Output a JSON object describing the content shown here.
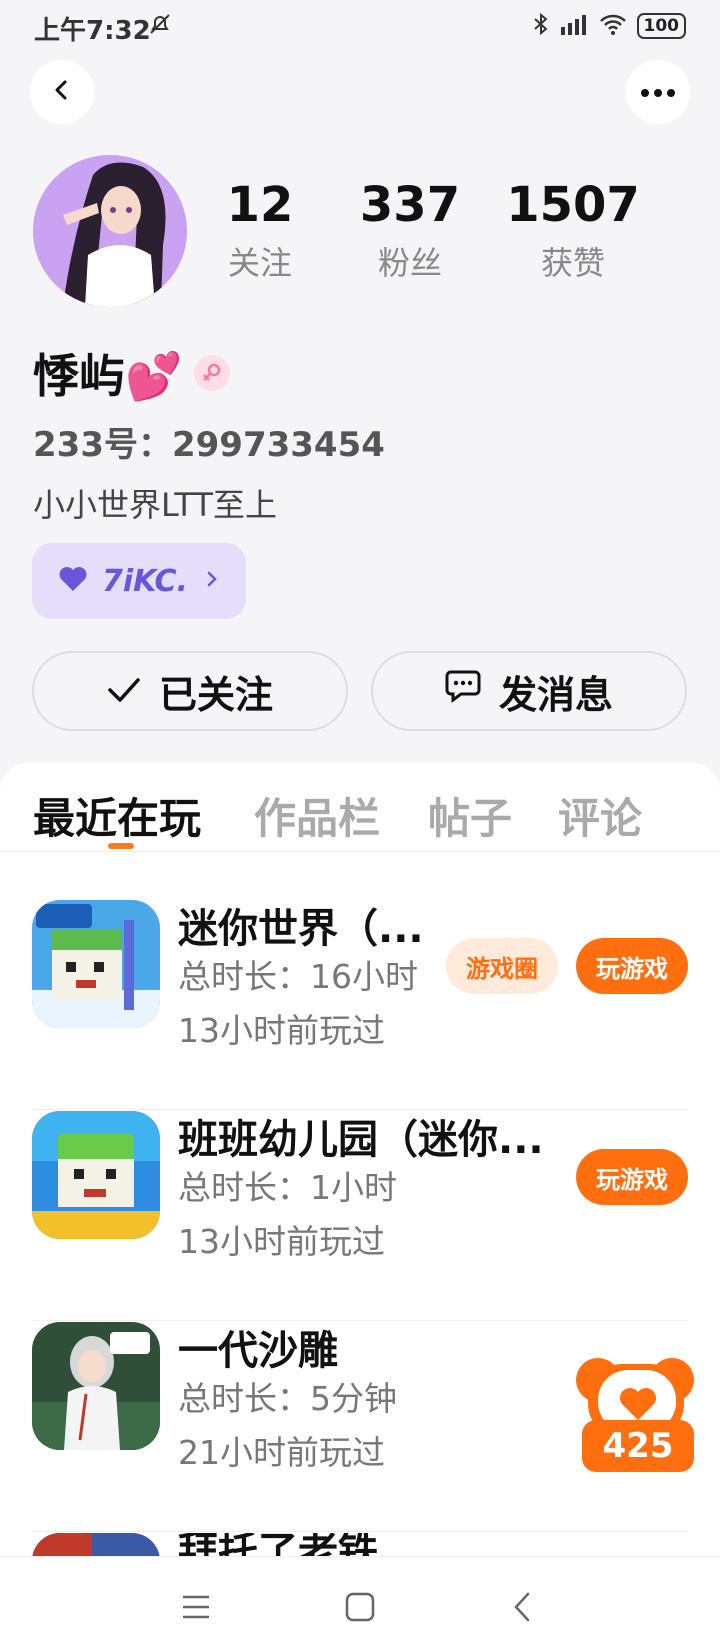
{
  "status_bar": {
    "time": "上午7:32",
    "battery": "100",
    "icons": [
      "mute-icon",
      "bluetooth-icon",
      "signal-icon",
      "wifi-icon",
      "battery-icon"
    ]
  },
  "header": {
    "back_icon": "chevron-left-icon",
    "more_icon": "more-dots-icon"
  },
  "profile": {
    "name": "悸屿💕",
    "gender_icon": "female-icon",
    "id_line": "233号：299733454",
    "bio": "小小世界LTT至上",
    "badge": {
      "icon": "heart-icon",
      "label": "7iKC.",
      "chevron": "chevron-right-icon"
    },
    "stats": [
      {
        "value": "12",
        "label": "关注"
      },
      {
        "value": "337",
        "label": "粉丝"
      },
      {
        "value": "1507",
        "label": "获赞"
      }
    ]
  },
  "actions": {
    "follow_label": "已关注",
    "message_label": "发消息"
  },
  "tabs": [
    {
      "label": "最近在玩",
      "active": true
    },
    {
      "label": "作品栏",
      "active": false
    },
    {
      "label": "帖子",
      "active": false
    },
    {
      "label": "评论",
      "active": false
    }
  ],
  "games": [
    {
      "title": "迷你世界（...",
      "duration": "总时长：16小时",
      "last_played": "13小时前玩过",
      "circle_label": "游戏圈",
      "play_label": "玩游戏"
    },
    {
      "title": "班班幼儿园（迷你...",
      "duration": "总时长：1小时",
      "last_played": "13小时前玩过",
      "play_label": "玩游戏"
    },
    {
      "title": "一代沙雕",
      "duration": "总时长：5分钟",
      "last_played": "21小时前玩过"
    },
    {
      "title": "拜托了老铁"
    }
  ],
  "like_float": {
    "count": "425"
  },
  "colors": {
    "accent": "#ff6f0f",
    "badge_bg": "#e4defa",
    "badge_text": "#6a56d8"
  }
}
